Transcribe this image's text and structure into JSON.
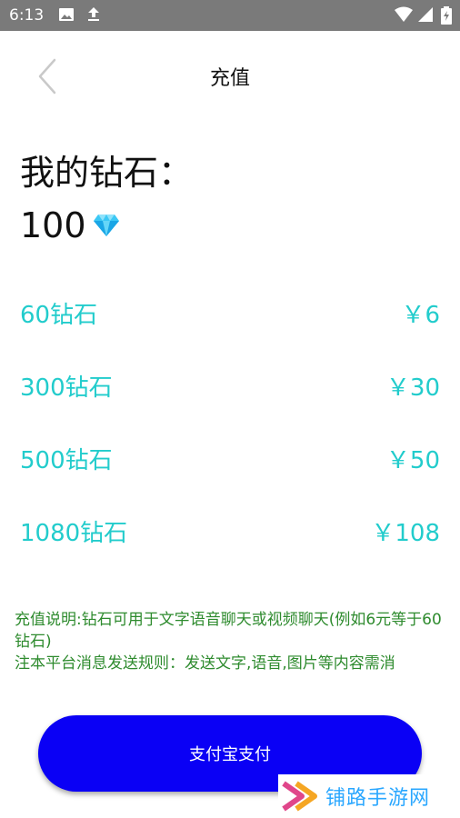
{
  "status_bar": {
    "time": "6:13",
    "icons": [
      "image-icon",
      "upload-icon",
      "wifi-icon",
      "signal-icon",
      "battery-icon"
    ]
  },
  "header": {
    "back_icon": "chevron-left-icon",
    "title": "充值"
  },
  "balance": {
    "label": "我的钻石：",
    "value": "100",
    "icon": "diamond-icon"
  },
  "options": [
    {
      "amount": "60钻石",
      "price": "￥6"
    },
    {
      "amount": "300钻石",
      "price": "￥30"
    },
    {
      "amount": "500钻石",
      "price": "￥50"
    },
    {
      "amount": "1080钻石",
      "price": "￥108"
    }
  ],
  "notes": {
    "line1": "充值说明:钻石可用于文字语音聊天或视频聊天(例如6元等于60钻石)",
    "line2": "注本平台消息发送规则：发送文字,语音,图片等内容需消"
  },
  "pay_button": {
    "label": "支付宝支付"
  },
  "watermark": {
    "text": "铺路手游网"
  },
  "colors": {
    "accent_teal": "#22cccc",
    "note_green": "#2e8b2e",
    "pay_blue": "#0a00f5",
    "status_bar": "#7a7a7a"
  }
}
